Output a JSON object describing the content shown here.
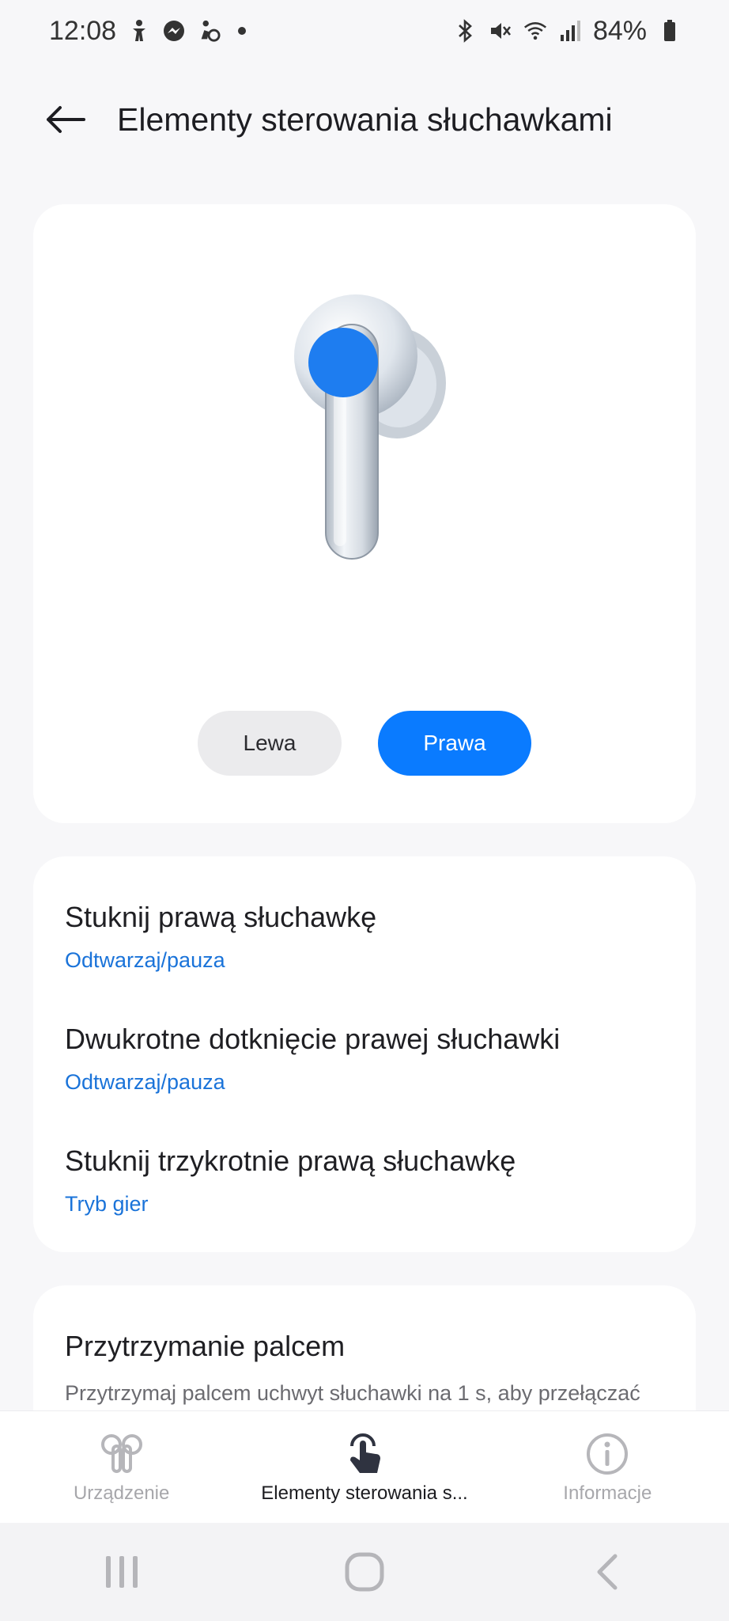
{
  "status_bar": {
    "time": "12:08",
    "battery": "84%",
    "left_icons": [
      "accessibility-icon",
      "messenger-icon",
      "run-icon"
    ],
    "right_icons": [
      "bluetooth-icon",
      "mute-icon",
      "wifi-icon",
      "signal-icon",
      "battery-icon"
    ]
  },
  "header": {
    "title": "Elementy sterowania słuchawkami"
  },
  "earbud_panel": {
    "left_label": "Lewa",
    "right_label": "Prawa",
    "selected": "Prawa",
    "accent_color": "#0a7bff"
  },
  "controls": [
    {
      "title": "Stuknij prawą słuchawkę",
      "value": "Odtwarzaj/pauza"
    },
    {
      "title": "Dwukrotne dotknięcie prawej słuchawki",
      "value": "Odtwarzaj/pauza"
    },
    {
      "title": "Stuknij trzykrotnie prawą słuchawkę",
      "value": "Tryb gier"
    }
  ],
  "hold": {
    "title": "Przytrzymanie palcem",
    "description": "Przytrzymaj palcem uchwyt słuchawki na 1 s, aby przełączać"
  },
  "bottom_tabs": [
    {
      "label": "Urządzenie",
      "icon": "earbuds-icon",
      "active": false
    },
    {
      "label": "Elementy sterowania s...",
      "icon": "touch-icon",
      "active": true
    },
    {
      "label": "Informacje",
      "icon": "info-icon",
      "active": false
    }
  ],
  "nav": [
    "recents-icon",
    "home-icon",
    "back-icon"
  ]
}
